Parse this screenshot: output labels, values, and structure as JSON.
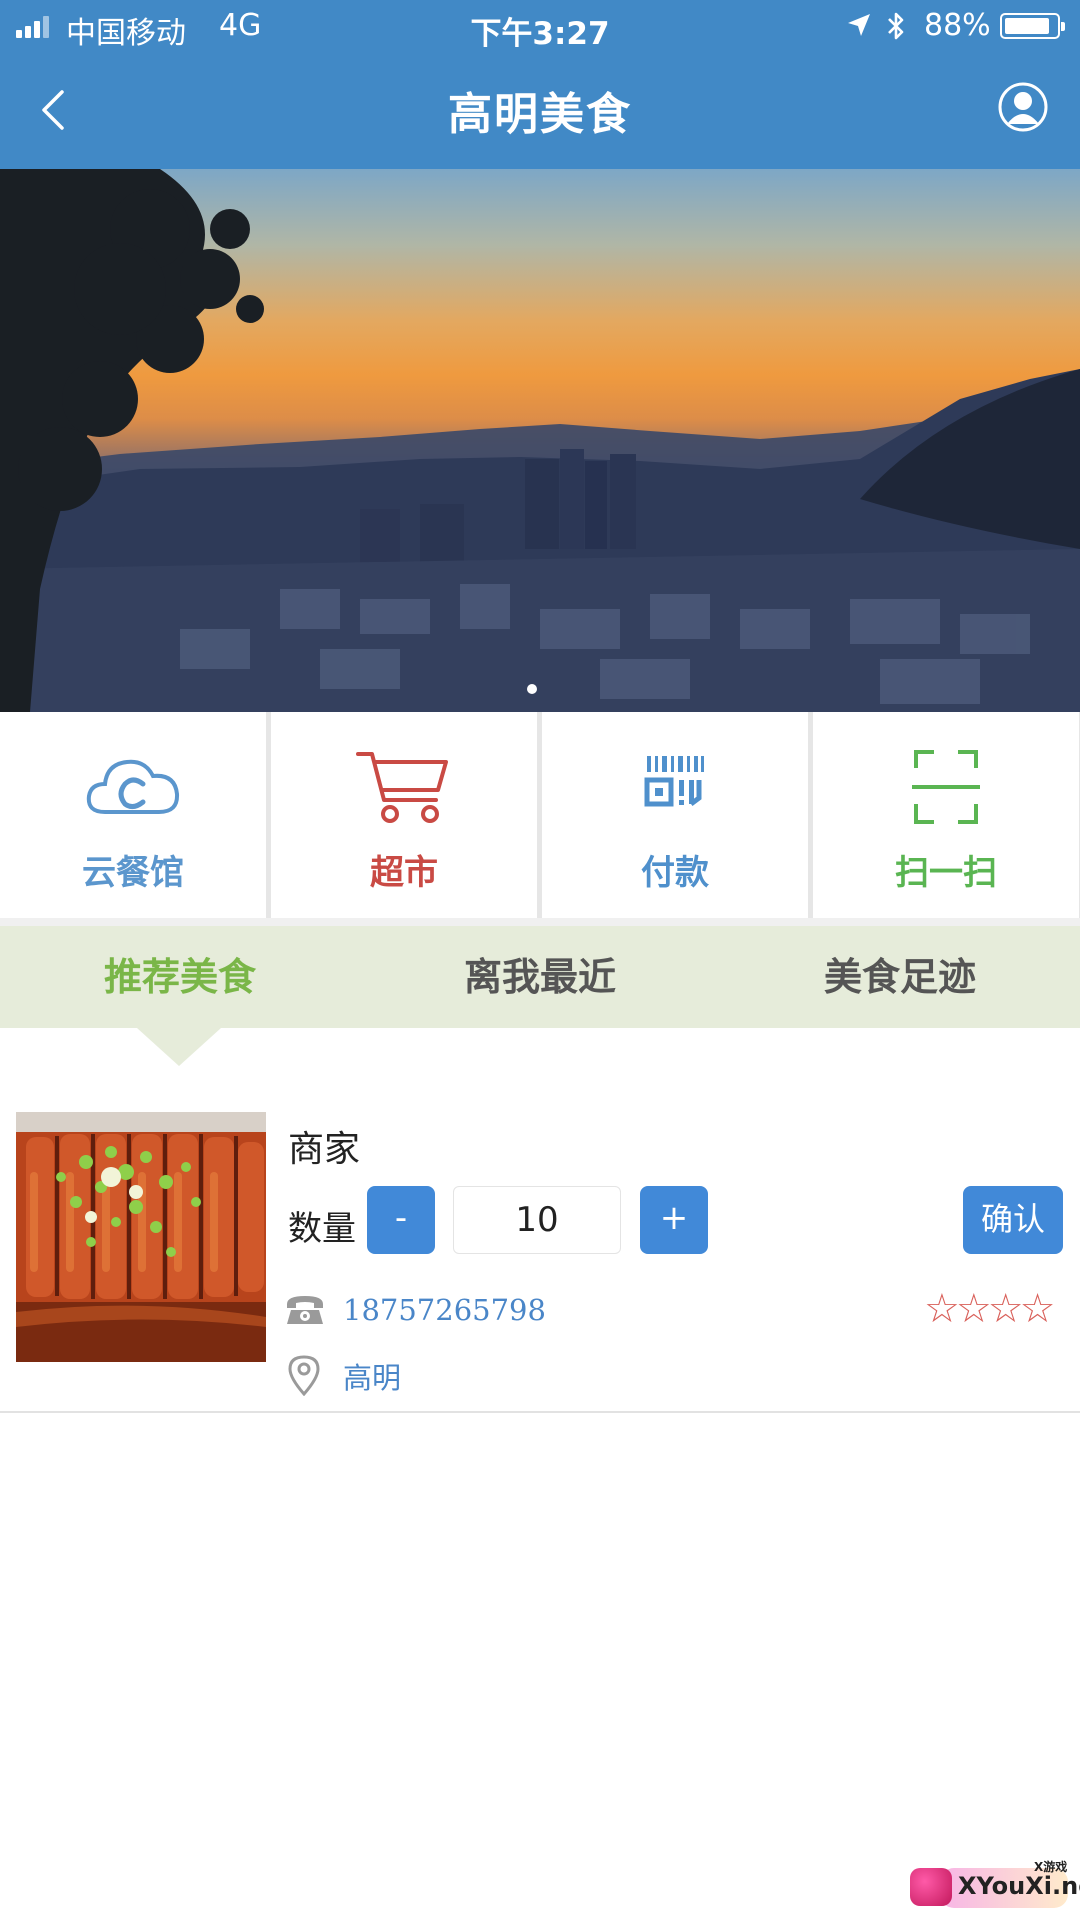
{
  "status_bar": {
    "carrier": "中国移动",
    "network": "4G",
    "time": "下午3:27",
    "battery_percent": "88%",
    "battery_level": 0.88,
    "icons": [
      "signal-icon",
      "location-arrow-icon",
      "bluetooth-icon",
      "battery-icon"
    ]
  },
  "nav": {
    "title": "高明美食",
    "back_icon": "chevron-left-icon",
    "profile_icon": "user-profile-icon"
  },
  "banner": {
    "image": "sunset-city-skyline",
    "current_slide": 1,
    "slide_count": 1
  },
  "quick_actions": [
    {
      "label": "云餐馆",
      "icon": "cloud-icon",
      "color": "#5b96cd"
    },
    {
      "label": "超市",
      "icon": "shopping-cart-icon",
      "color": "#c94a44"
    },
    {
      "label": "付款",
      "icon": "barcode-pay-icon",
      "color": "#4f90cc"
    },
    {
      "label": "扫一扫",
      "icon": "scan-frame-icon",
      "color": "#5ab552"
    }
  ],
  "tabs": {
    "items": [
      {
        "label": "推荐美食",
        "active": true
      },
      {
        "label": "离我最近",
        "active": false
      },
      {
        "label": "美食足迹",
        "active": false
      }
    ],
    "active_color": "#7ab648",
    "inactive_color": "#555555"
  },
  "merchant": {
    "name": "商家",
    "image": "braised-pork-dish",
    "quantity_label": "数量",
    "quantity_value": "10",
    "minus_label": "-",
    "plus_label": "+",
    "confirm_label": "确认",
    "phone": "18757265798",
    "phone_icon": "telephone-icon",
    "location": "高明",
    "location_icon": "map-pin-icon",
    "rating_stars": "☆☆☆☆",
    "rating": 0,
    "rating_max": 4
  },
  "watermark": {
    "text": "XYouXi.net",
    "small": "X游戏"
  },
  "colors": {
    "primary": "#4189c6",
    "button_blue": "#4189d8",
    "tab_bg": "#e6ecda",
    "link_blue": "#4a86c8",
    "star_red": "#d9605a"
  }
}
